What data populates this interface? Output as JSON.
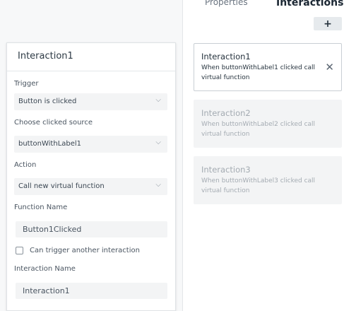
{
  "tabs": {
    "properties": "Properties",
    "interactions": "Interactions"
  },
  "add_label": "+",
  "cards": [
    {
      "title": "Interaction1",
      "desc": "When buttonWithLabel1 clicked call virtual function",
      "selected": true
    },
    {
      "title": "Interaction2",
      "desc": "When buttonWithLabel2 clicked call virtual function",
      "selected": false
    },
    {
      "title": "Interaction3",
      "desc": "When buttonWithLabel3 clicked call virtual function",
      "selected": false
    }
  ],
  "close_glyph": "✕",
  "editor": {
    "title": "Interaction1",
    "trigger_label": "Trigger",
    "trigger_value": "Button is clicked",
    "source_label": "Choose clicked source",
    "source_value": "buttonWithLabel1",
    "action_label": "Action",
    "action_value": "Call new virtual function",
    "function_label": "Function Name",
    "function_value": "Button1Clicked",
    "checkbox_label": "Can trigger another interaction",
    "checkbox_checked": false,
    "name_label": "Interaction Name",
    "name_value": "Interaction1"
  },
  "chevron_glyph": "⌵"
}
